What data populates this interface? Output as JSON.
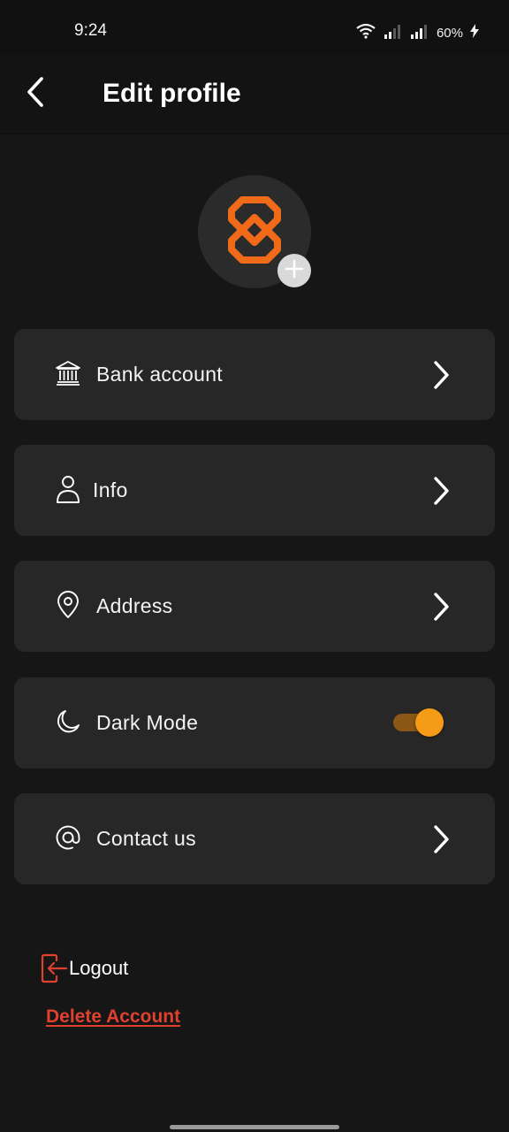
{
  "status_bar": {
    "time": "9:24",
    "battery_text": "60%",
    "icons": [
      "wifi-icon",
      "signal-icon",
      "signal-icon",
      "charging-icon"
    ]
  },
  "app_bar": {
    "back_icon": "back-arrow-icon",
    "title": "Edit profile"
  },
  "avatar": {
    "logo_icon": "flower-logo-icon",
    "add_icon": "plus-icon",
    "logo_color": "#f06a1a"
  },
  "menu": {
    "items": [
      {
        "label": "Bank account",
        "icon": "bank-icon",
        "trailing": "chevron-right-icon"
      },
      {
        "label": "Info",
        "icon": "user-icon",
        "trailing": "chevron-right-icon"
      },
      {
        "label": "Address",
        "icon": "location-pin-icon",
        "trailing": "chevron-right-icon"
      },
      {
        "label": "Dark Mode",
        "icon": "moon-icon",
        "trailing": "toggle",
        "toggle_on": true
      },
      {
        "label": "Contact us",
        "icon": "at-icon",
        "trailing": "chevron-right-icon"
      }
    ]
  },
  "footer": {
    "logout_label": "Logout",
    "logout_icon": "logout-icon",
    "delete_label": "Delete Account"
  },
  "colors": {
    "background": "#161616",
    "card": "#272727",
    "accent": "#f59b16",
    "logo": "#f06a1a",
    "danger": "#e0402e"
  }
}
